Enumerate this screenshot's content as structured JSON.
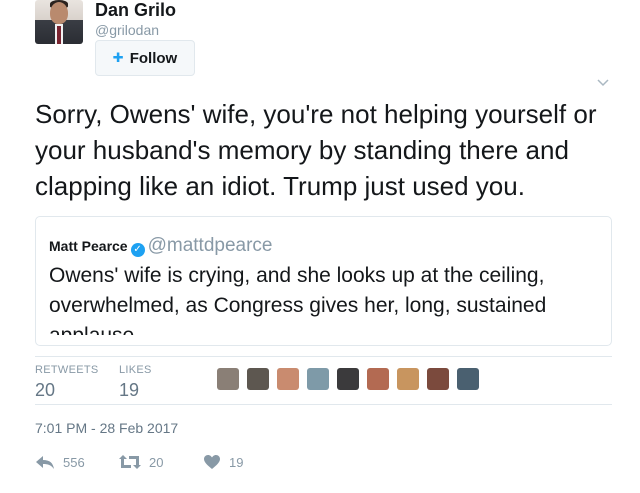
{
  "author": {
    "name": "Dan Grilo",
    "handle": "@grilodan",
    "follow_label": "Follow"
  },
  "tweet": {
    "text": "Sorry, Owens' wife, you're not helping yourself or your husband's memory by standing there and clapping like an idiot. Trump just used you."
  },
  "quoted_tweet": {
    "name": "Matt Pearce",
    "handle": "@mattdpearce",
    "text": "Owens' wife is crying, and she looks up at the ceiling, overwhelmed, as Congress gives her, long, sustained applause."
  },
  "stats": {
    "retweets_label": "RETWEETS",
    "retweets_value": "20",
    "likes_label": "LIKES",
    "likes_value": "19"
  },
  "likers": [
    "#8a7f76",
    "#5d5750",
    "#c98b6f",
    "#7e9aa8",
    "#3b3a3c",
    "#b36a52",
    "#c8955f",
    "#7b4a3d",
    "#4a6070"
  ],
  "timestamp": "7:01 PM - 28 Feb 2017",
  "actions": {
    "reply_count": "556",
    "retweet_count": "20",
    "like_count": "19"
  },
  "colors": {
    "accent": "#1da1f2",
    "muted": "#8899a6",
    "border": "#e1e8ed"
  }
}
